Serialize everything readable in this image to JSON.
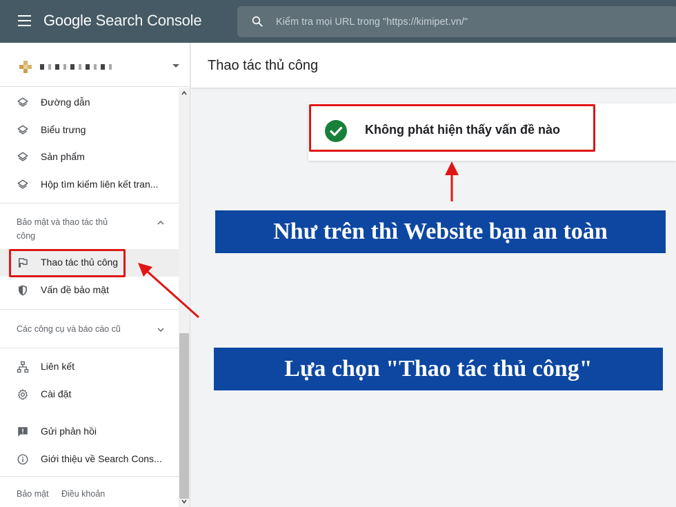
{
  "topbar": {
    "brand_google": "Google",
    "brand_product": "Search Console",
    "search_placeholder": "Kiểm tra mọi URL trong \"https://kimipet.vn/\""
  },
  "sidebar": {
    "enhancement_items": [
      {
        "label": "Đường dẫn",
        "icon": "layers-icon"
      },
      {
        "label": "Biểu trưng",
        "icon": "layers-icon"
      },
      {
        "label": "Sản phẩm",
        "icon": "layers-icon"
      },
      {
        "label": "Hộp tìm kiếm liên kết tran...",
        "icon": "layers-icon"
      }
    ],
    "security_section": {
      "title": "Bảo mật và thao tác thủ công",
      "items": [
        {
          "label": "Thao tác thủ công",
          "icon": "flag-icon",
          "active": true
        },
        {
          "label": "Vấn đề bảo mật",
          "icon": "shield-icon"
        }
      ]
    },
    "legacy_section": {
      "title": "Các công cụ và báo cáo cũ"
    },
    "bottom_items": [
      {
        "label": "Liên kết",
        "icon": "sitemap-icon"
      },
      {
        "label": "Cài đặt",
        "icon": "gear-icon"
      },
      {
        "label": "Gửi phản hồi",
        "icon": "feedback-icon"
      },
      {
        "label": "Giới thiệu về Search Cons...",
        "icon": "info-icon"
      }
    ],
    "footer": {
      "privacy": "Bảo mật",
      "terms": "Điều khoản"
    }
  },
  "main": {
    "page_title": "Thao tác thủ công",
    "status_text": "Không phát hiện thấy vấn đề nào"
  },
  "annotations": {
    "banner_top": "Như trên thì Website bạn an toàn",
    "banner_bottom": "Lựa chọn \"Thao tác thủ công\"",
    "banner_color": "#0d47a1",
    "highlight_color": "#e01515"
  }
}
